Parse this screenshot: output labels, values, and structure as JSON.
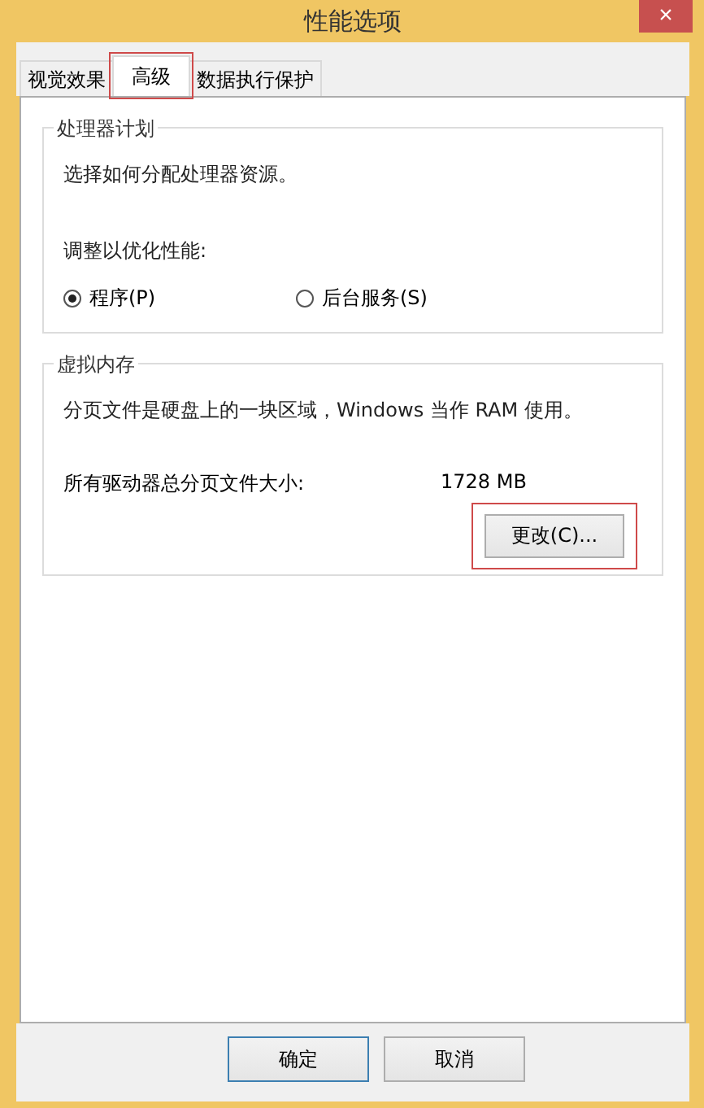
{
  "window": {
    "title": "性能选项",
    "close": "×"
  },
  "tabs": [
    {
      "label": "视觉效果",
      "selected": false,
      "highlighted": false
    },
    {
      "label": "高级",
      "selected": true,
      "highlighted": true
    },
    {
      "label": "数据执行保护",
      "selected": false,
      "highlighted": false
    }
  ],
  "processor_scheduling": {
    "legend": "处理器计划",
    "description": "选择如何分配处理器资源。",
    "adjust_label": "调整以优化性能:",
    "options": [
      {
        "label": "程序(P)",
        "selected": true
      },
      {
        "label": "后台服务(S)",
        "selected": false
      }
    ]
  },
  "virtual_memory": {
    "legend": "虚拟内存",
    "description": "分页文件是硬盘上的一块区域，Windows 当作 RAM 使用。",
    "size_label": "所有驱动器总分页文件大小:",
    "size_value": "1728 MB",
    "change_button": {
      "label": "更改(C)...",
      "highlighted": true
    }
  },
  "buttons": [
    {
      "label": "确定",
      "default": true
    },
    {
      "label": "取消",
      "default": false
    }
  ]
}
